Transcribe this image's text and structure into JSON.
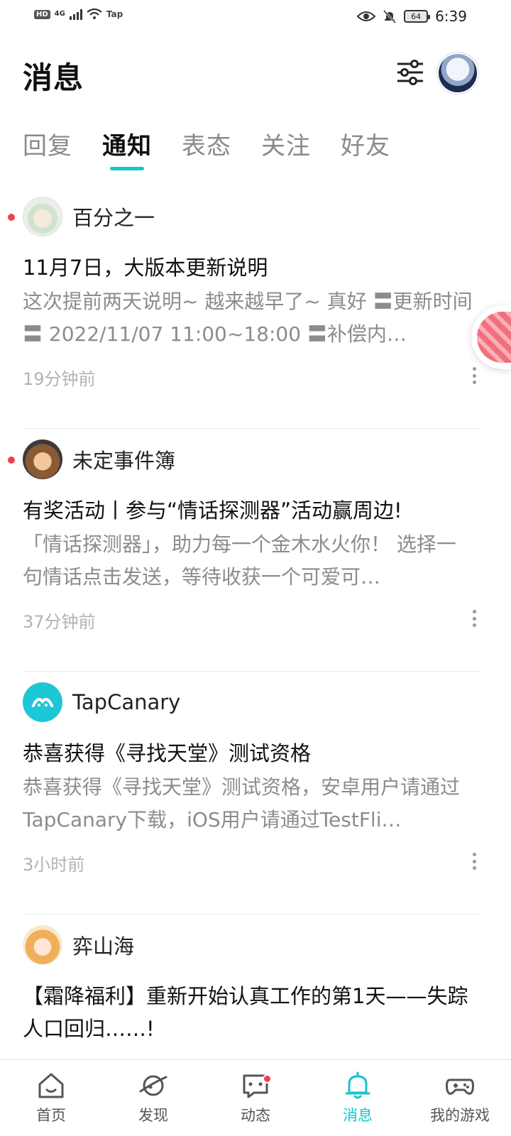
{
  "status_bar": {
    "hd": "HD",
    "network": "4G",
    "carrier_app": "Tap",
    "battery": "64",
    "time": "6:39"
  },
  "header": {
    "title": "消息",
    "filter_icon": "sliders-icon",
    "avatar_icon": "user-avatar"
  },
  "tabs": [
    {
      "label": "回复",
      "active": false
    },
    {
      "label": "通知",
      "active": true
    },
    {
      "label": "表态",
      "active": false
    },
    {
      "label": "关注",
      "active": false
    },
    {
      "label": "好友",
      "active": false
    }
  ],
  "notifications": [
    {
      "sender": "百分之一",
      "unread": true,
      "title": "11月7日，大版本更新说明",
      "excerpt": "这次提前两天说明~ 越来越早了~ 真好 〓更新时间〓 2022/11/07 11:00~18:00 〓补偿内…",
      "time": "19分钟前"
    },
    {
      "sender": "未定事件簿",
      "unread": true,
      "title": "有奖活动丨参与“情话探测器”活动赢周边!",
      "excerpt": "「情话探测器」，助力每一个金木水火你！ 选择一句情话点击发送，等待收获一个可爱可…",
      "time": "37分钟前"
    },
    {
      "sender": "TapCanary",
      "unread": false,
      "title": "恭喜获得《寻找天堂》测试资格",
      "excerpt": "恭喜获得《寻找天堂》测试资格，安卓用户请通过TapCanary下载，iOS用户请通过TestFli…",
      "time": "3小时前"
    },
    {
      "sender": "弈山海",
      "unread": false,
      "title": "【霜降福利】重新开始认真工作的第1天——失踪人口回归……!",
      "excerpt": "",
      "time": ""
    }
  ],
  "bottom_nav": [
    {
      "label": "首页",
      "icon": "home-icon",
      "active": false,
      "dot": false
    },
    {
      "label": "发现",
      "icon": "planet-icon",
      "active": false,
      "dot": false
    },
    {
      "label": "动态",
      "icon": "chat-icon",
      "active": false,
      "dot": true
    },
    {
      "label": "消息",
      "icon": "bell-icon",
      "active": true,
      "dot": false
    },
    {
      "label": "我的游戏",
      "icon": "gamepad-icon",
      "active": false,
      "dot": false
    }
  ],
  "colors": {
    "accent": "#15c5ce",
    "unread_dot": "#f0414e",
    "muted_text": "#8c8c8c"
  }
}
